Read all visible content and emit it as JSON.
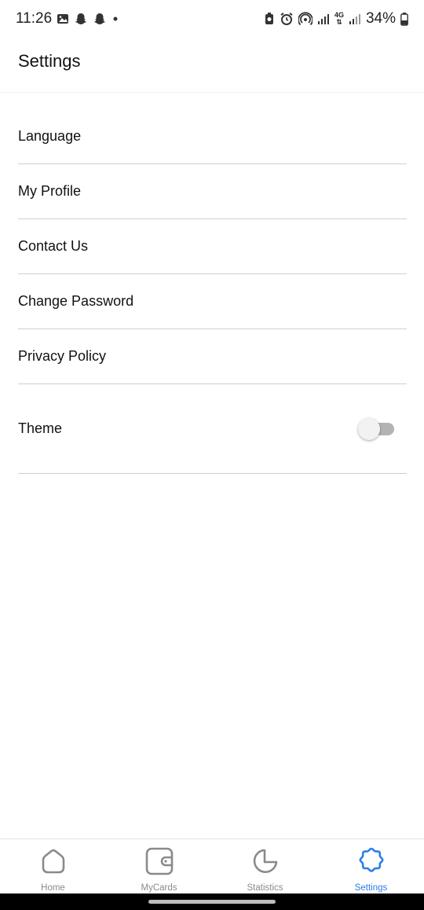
{
  "status_bar": {
    "time": "11:26",
    "battery_percent": "34%",
    "network_label": "4G"
  },
  "header": {
    "title": "Settings"
  },
  "settings": {
    "items": [
      {
        "label": "Language"
      },
      {
        "label": "My Profile"
      },
      {
        "label": "Contact Us"
      },
      {
        "label": "Change Password"
      },
      {
        "label": "Privacy Policy"
      }
    ],
    "theme": {
      "label": "Theme",
      "toggle_on": false
    }
  },
  "bottom_nav": {
    "items": [
      {
        "label": "Home",
        "icon": "home-icon",
        "active": false
      },
      {
        "label": "MyCards",
        "icon": "wallet-icon",
        "active": false
      },
      {
        "label": "Statistics",
        "icon": "pie-chart-icon",
        "active": false
      },
      {
        "label": "Settings",
        "icon": "gear-icon",
        "active": true
      }
    ]
  },
  "colors": {
    "accent": "#2b7de9",
    "inactive_nav": "#8a8a8a",
    "divider": "#cfcfcf",
    "toggle_track": "#b3b3b3"
  }
}
